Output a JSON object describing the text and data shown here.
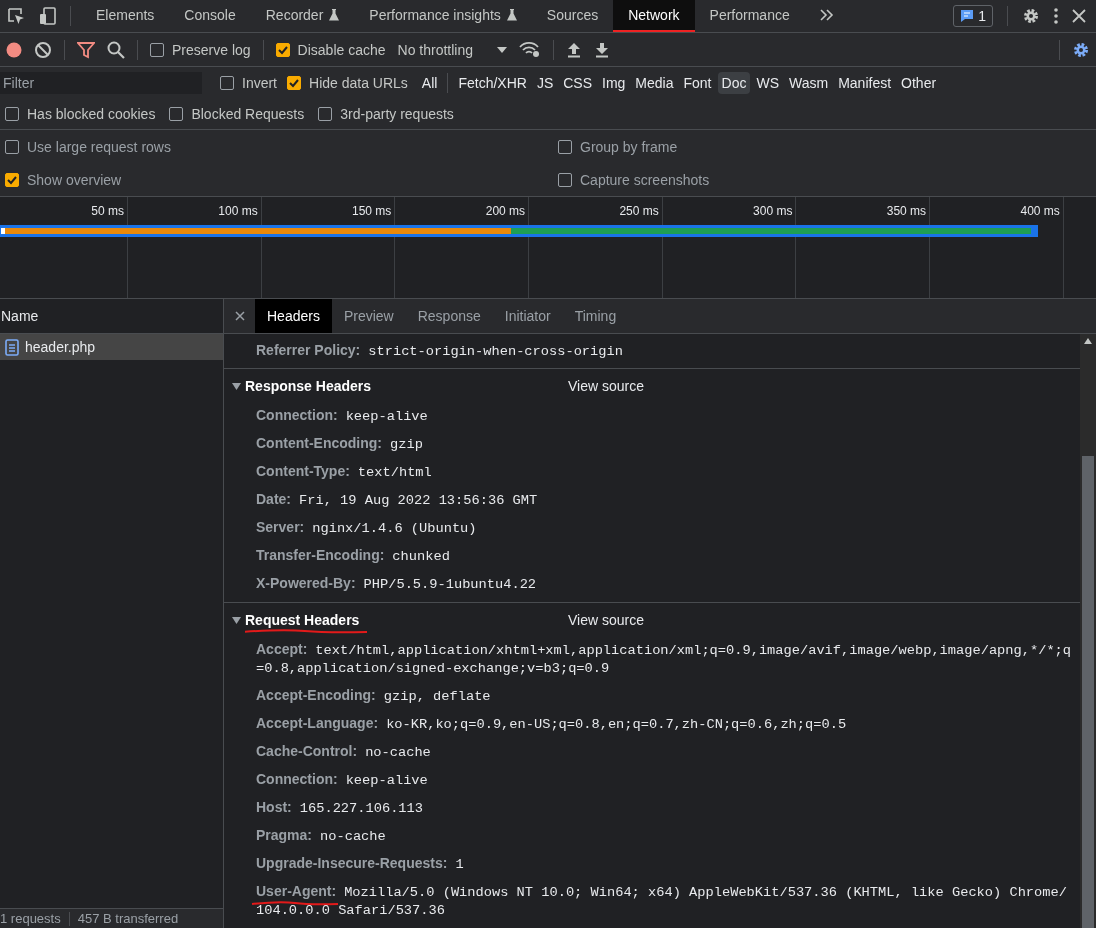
{
  "main_tabs": [
    {
      "label": "Elements",
      "kind": "plain",
      "selected": false
    },
    {
      "label": "Console",
      "kind": "plain",
      "selected": false
    },
    {
      "label": "Recorder",
      "kind": "experimental",
      "selected": false
    },
    {
      "label": "Performance insights",
      "kind": "experimental",
      "selected": false
    },
    {
      "label": "Sources",
      "kind": "plain",
      "selected": false
    },
    {
      "label": "Network",
      "kind": "plain",
      "selected": true
    },
    {
      "label": "Performance",
      "kind": "plain",
      "selected": false
    }
  ],
  "issues_badge": "1",
  "toolbar": {
    "recording": true,
    "filter_active": true,
    "preserve_log": {
      "label": "Preserve log",
      "checked": false
    },
    "disable_cache": {
      "label": "Disable cache",
      "checked": true
    },
    "throttling": "No throttling"
  },
  "filter": {
    "placeholder": "Filter",
    "invert": {
      "label": "Invert",
      "checked": false
    },
    "hide_data_urls": {
      "label": "Hide data URLs",
      "checked": true
    },
    "types": [
      {
        "label": "All",
        "selected": false
      },
      {
        "label": "Fetch/XHR",
        "selected": false
      },
      {
        "label": "JS",
        "selected": false
      },
      {
        "label": "CSS",
        "selected": false
      },
      {
        "label": "Img",
        "selected": false
      },
      {
        "label": "Media",
        "selected": false
      },
      {
        "label": "Font",
        "selected": false
      },
      {
        "label": "Doc",
        "selected": true
      },
      {
        "label": "WS",
        "selected": false
      },
      {
        "label": "Wasm",
        "selected": false
      },
      {
        "label": "Manifest",
        "selected": false
      },
      {
        "label": "Other",
        "selected": false
      }
    ]
  },
  "filter_checks": [
    {
      "label": "Has blocked cookies",
      "checked": false
    },
    {
      "label": "Blocked Requests",
      "checked": false
    },
    {
      "label": "3rd-party requests",
      "checked": false
    }
  ],
  "settings": [
    {
      "label": "Use large request rows",
      "checked": false
    },
    {
      "label": "Group by frame",
      "checked": false
    },
    {
      "label": "Show overview",
      "checked": true
    },
    {
      "label": "Capture screenshots",
      "checked": false
    }
  ],
  "overview": {
    "ticks": [
      "50 ms",
      "100 ms",
      "150 ms",
      "200 ms",
      "250 ms",
      "300 ms",
      "350 ms",
      "400 ms"
    ]
  },
  "request_list": {
    "column": "Name",
    "rows": [
      {
        "name": "header.php",
        "selected": true
      }
    ]
  },
  "status_bar": [
    "1 requests",
    "457 B transferred"
  ],
  "detail_tabs": [
    {
      "label": "Headers",
      "selected": true
    },
    {
      "label": "Preview",
      "selected": false
    },
    {
      "label": "Response",
      "selected": false
    },
    {
      "label": "Initiator",
      "selected": false
    },
    {
      "label": "Timing",
      "selected": false
    }
  ],
  "general_tail": [
    {
      "name": "Referrer Policy:",
      "value": "strict-origin-when-cross-origin",
      "underlined": false
    }
  ],
  "sections": [
    {
      "title": "Response Headers",
      "expanded": true,
      "underlined": false,
      "view_source": "View source",
      "headers": [
        {
          "name": "Connection:",
          "value": "keep-alive",
          "underlined": false
        },
        {
          "name": "Content-Encoding:",
          "value": "gzip",
          "underlined": false
        },
        {
          "name": "Content-Type:",
          "value": "text/html",
          "underlined": false
        },
        {
          "name": "Date:",
          "value": "Fri, 19 Aug 2022 13:56:36 GMT",
          "underlined": false
        },
        {
          "name": "Server:",
          "value": "nginx/1.4.6 (Ubuntu)",
          "underlined": false
        },
        {
          "name": "Transfer-Encoding:",
          "value": "chunked",
          "underlined": false
        },
        {
          "name": "X-Powered-By:",
          "value": "PHP/5.5.9-1ubuntu4.22",
          "underlined": false
        }
      ]
    },
    {
      "title": "Request Headers",
      "expanded": true,
      "underlined": true,
      "view_source": "View source",
      "headers": [
        {
          "name": "Accept:",
          "value": "text/html,application/xhtml+xml,application/xml;q=0.9,image/avif,image/webp,image/apng,*/*;q=0.8,application/signed-exchange;v=b3;q=0.9",
          "underlined": false
        },
        {
          "name": "Accept-Encoding:",
          "value": "gzip, deflate",
          "underlined": false
        },
        {
          "name": "Accept-Language:",
          "value": "ko-KR,ko;q=0.9,en-US;q=0.8,en;q=0.7,zh-CN;q=0.6,zh;q=0.5",
          "underlined": false
        },
        {
          "name": "Cache-Control:",
          "value": "no-cache",
          "underlined": false
        },
        {
          "name": "Connection:",
          "value": "keep-alive",
          "underlined": false
        },
        {
          "name": "Host:",
          "value": "165.227.106.113",
          "underlined": false
        },
        {
          "name": "Pragma:",
          "value": "no-cache",
          "underlined": false
        },
        {
          "name": "Upgrade-Insecure-Requests:",
          "value": "1",
          "underlined": false
        },
        {
          "name": "User-Agent:",
          "value": "Mozilla/5.0 (Windows NT 10.0; Win64; x64) AppleWebKit/537.36 (KHTML, like Gecko) Chrome/104.0.0.0 Safari/537.36",
          "underlined": true
        }
      ]
    }
  ]
}
